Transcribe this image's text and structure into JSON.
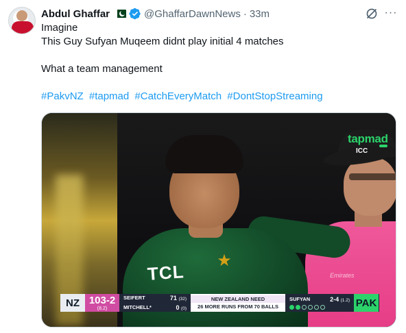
{
  "tweet": {
    "author_name": "Abdul Ghaffar",
    "handle": "@GhaffarDawnNews",
    "separator": "·",
    "time": "33m",
    "text_lines": [
      "Imagine",
      "This Guy Sufyan Muqeem didnt play initial 4 matches",
      "",
      "What a team management"
    ],
    "hashtags": [
      "#PakvNZ",
      "#tapmad",
      "#CatchEveryMatch",
      "#DontStopStreaming"
    ],
    "more_glyph": "···"
  },
  "colors": {
    "link": "#1d9bf0",
    "verified": "#1d9bf0",
    "text": "#0f1419",
    "muted": "#536471"
  },
  "icons": {
    "verified": "verified-badge-icon",
    "flag": "pakistan-flag-icon",
    "grok": "grok-icon",
    "more": "more-icon"
  },
  "media": {
    "watermark": "tapmad",
    "jersey_text": "TCL",
    "hat_badge": "ICC",
    "umpire_text": "Emirates",
    "scorebar": {
      "batting_team": "NZ",
      "score": "103-2",
      "overs": "(8.2)",
      "batter1_name": "SEIFERT",
      "batter1_runs": "71",
      "batter1_balls": "(32)",
      "batter2_name": "MITCHELL*",
      "batter2_runs": "0",
      "batter2_balls": "(0)",
      "need_line1": "NEW ZEALAND NEED",
      "need_line2": "26 MORE RUNS FROM 70 BALLS",
      "bowler_name": "SUFYAN",
      "bowler_figures": "2-4",
      "bowler_overs": "(1.2)",
      "bowling_team": "PAK"
    }
  }
}
